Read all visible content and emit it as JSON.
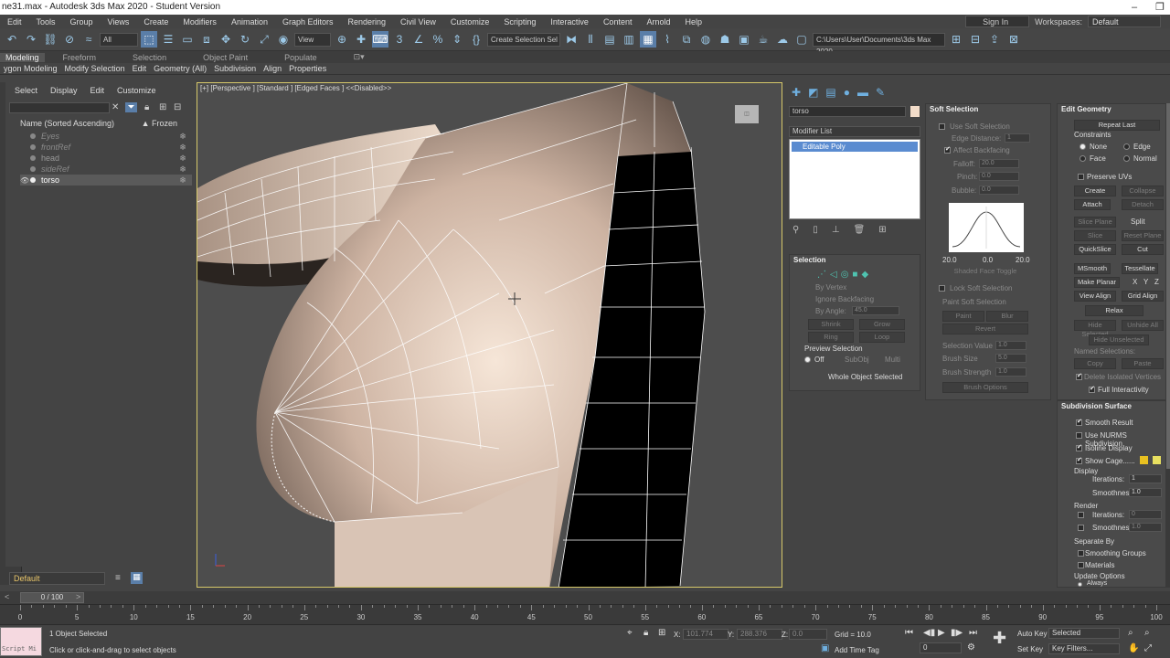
{
  "title": "ne31.max - Autodesk 3ds Max 2020 - Student Version",
  "menu": [
    "Edit",
    "Tools",
    "Group",
    "Views",
    "Create",
    "Modifiers",
    "Animation",
    "Graph Editors",
    "Rendering",
    "Civil View",
    "Customize",
    "Scripting",
    "Interactive",
    "Content",
    "Arnold",
    "Help"
  ],
  "account": {
    "sign_in": "Sign In",
    "workspaces_label": "Workspaces:",
    "workspace": "Default"
  },
  "toolbar": {
    "filter": "All",
    "view": "View",
    "selection_set": "Create Selection Sel",
    "path": "C:\\Users\\User\\Documents\\3ds Max 2020"
  },
  "ribbon_tabs": [
    "Modeling",
    "Freeform",
    "Selection",
    "Object Paint",
    "Populate"
  ],
  "ribbon_sub": [
    "ygon Modeling",
    "Modify Selection",
    "Edit",
    "Geometry (All)",
    "Subdivision",
    "Align",
    "Properties"
  ],
  "scene_explorer": {
    "menu": [
      "Select",
      "Display",
      "Edit",
      "Customize"
    ],
    "col_name": "Name (Sorted Ascending)",
    "col_frozen": "▲ Frozen",
    "items": [
      {
        "name": "Eyes"
      },
      {
        "name": "frontRef"
      },
      {
        "name": "head"
      },
      {
        "name": "sideRef"
      },
      {
        "name": "torso"
      }
    ],
    "layer": "Default"
  },
  "viewport": {
    "label": "[+] [Perspective ] [Standard ] [Edged Faces ]  <<Disabled>>"
  },
  "command_panel": {
    "object_name": "torso",
    "modifier_list": "Modifier List",
    "stack_item": "Editable Poly",
    "colors": {
      "object": "#f2dcc9",
      "stack_highlight": "#5a8bd0"
    }
  },
  "selection": {
    "title": "Selection",
    "by_vertex": "By Vertex",
    "ignore_backfacing": "Ignore Backfacing",
    "by_angle": "By Angle:",
    "angle_value": "45.0",
    "shrink": "Shrink",
    "grow": "Grow",
    "ring": "Ring",
    "loop": "Loop",
    "preview": "Preview Selection",
    "off": "Off",
    "subobj": "SubObj",
    "multi": "Multi",
    "status": "Whole Object Selected"
  },
  "soft_selection": {
    "title": "Soft Selection",
    "use": "Use Soft Selection",
    "edge_distance": "Edge Distance:",
    "edge_value": "1",
    "affect_backfacing": "Affect Backfacing",
    "falloff": "Falloff:",
    "falloff_value": "20.0",
    "pinch": "Pinch:",
    "pinch_value": "0.0",
    "bubble": "Bubble:",
    "bubble_value": "0.0",
    "curve_labels": [
      "20.0",
      "0.0",
      "20.0"
    ],
    "shaded_toggle": "Shaded Face Toggle",
    "lock": "Lock Soft Selection",
    "paint": "Paint Soft Selection",
    "paint_btn": "Paint",
    "blur_btn": "Blur",
    "revert_btn": "Revert",
    "sel_value": "Selection Value",
    "sel_value_v": "1.0",
    "brush_size": "Brush Size",
    "brush_size_v": "5.0",
    "brush_strength": "Brush Strength",
    "brush_strength_v": "1.0",
    "brush_options": "Brush Options"
  },
  "edit_geometry": {
    "title": "Edit Geometry",
    "repeat_last": "Repeat Last",
    "constraints": "Constraints",
    "none": "None",
    "edge": "Edge",
    "face": "Face",
    "normal": "Normal",
    "preserve_uvs": "Preserve UVs",
    "create": "Create",
    "collapse": "Collapse",
    "attach": "Attach",
    "detach": "Detach",
    "slice_plane": "Slice Plane",
    "split": "Split",
    "slice": "Slice",
    "reset_plane": "Reset Plane",
    "quickslice": "QuickSlice",
    "cut": "Cut",
    "msmooth": "MSmooth",
    "tessellate": "Tessellate",
    "make_planar": "Make Planar",
    "x": "X",
    "y": "Y",
    "z": "Z",
    "view_align": "View Align",
    "grid_align": "Grid Align",
    "relax": "Relax",
    "hide_selected": "Hide Selected",
    "unhide_all": "Unhide All",
    "hide_unselected": "Hide Unselected",
    "named_selections": "Named Selections:",
    "copy": "Copy",
    "paste": "Paste",
    "delete_isolated": "Delete Isolated Vertices",
    "full_interactivity": "Full Interactivity"
  },
  "subdivision": {
    "title": "Subdivision Surface",
    "smooth_result": "Smooth Result",
    "use_nurms": "Use NURMS Subdivision",
    "isoline": "Isoline Display",
    "show_cage": "Show Cage......",
    "display": "Display",
    "iterations": "Iterations:",
    "iter_value": "1",
    "smoothness": "Smoothness:",
    "smooth_value": "1.0",
    "render": "Render",
    "r_iter_value": "0",
    "r_smooth_value": "1.0",
    "separate_by": "Separate By",
    "smoothing_groups": "Smoothing Groups",
    "materials": "Materials",
    "update_options": "Update Options",
    "always": "Always",
    "cage_colors": [
      "#e8c020",
      "#e8e060"
    ]
  },
  "timeline": {
    "frame": "0 / 100",
    "start": 0,
    "end": 100,
    "step": 5
  },
  "status": {
    "maxscript": "Script Mi",
    "selected": "1 Object Selected",
    "hint": "Click or click-and-drag to select objects",
    "x_label": "X:",
    "x_value": "101.774",
    "y_label": "Y:",
    "y_value": "288.376",
    "z_label": "Z:",
    "z_value": "0.0",
    "grid": "Grid = 10.0",
    "add_time_tag": "Add Time Tag",
    "frame": "0",
    "auto_key": "Auto Key",
    "set_key": "Set Key",
    "key_mode": "Selected",
    "key_filters": "Key Filters..."
  }
}
